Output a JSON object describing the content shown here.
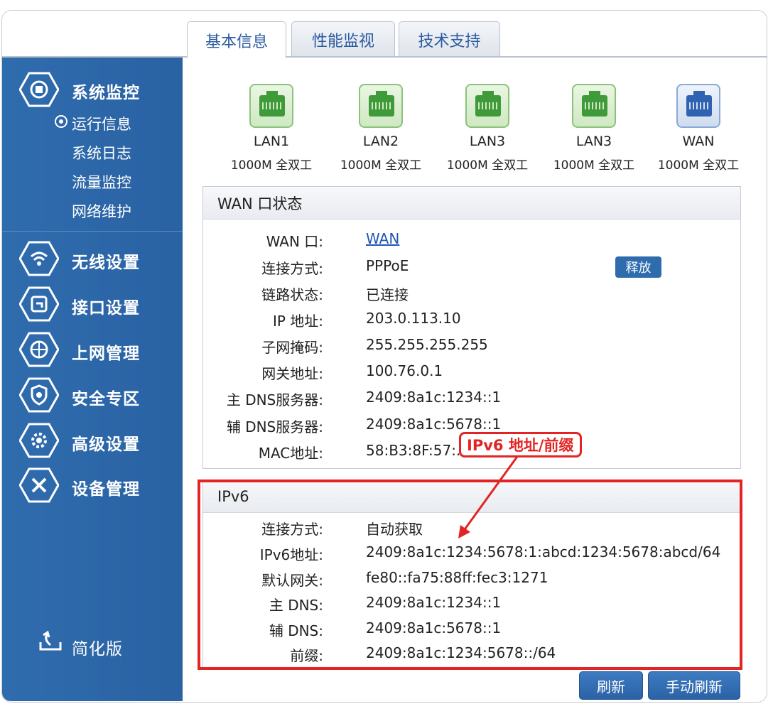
{
  "tabs": [
    {
      "label": "基本信息",
      "active": true
    },
    {
      "label": "性能监视",
      "active": false
    },
    {
      "label": "技术支持",
      "active": false
    }
  ],
  "sidebar": {
    "sections": [
      {
        "label": "系统监控",
        "icon": "router-icon"
      },
      {
        "label": "无线设置",
        "icon": "wifi-icon"
      },
      {
        "label": "接口设置",
        "icon": "interface-icon"
      },
      {
        "label": "上网管理",
        "icon": "globe-icon"
      },
      {
        "label": "安全专区",
        "icon": "shield-icon"
      },
      {
        "label": "高级设置",
        "icon": "gear-icon"
      },
      {
        "label": "设备管理",
        "icon": "tools-icon"
      }
    ],
    "subitems": [
      "运行信息",
      "系统日志",
      "流量监控",
      "网络维护"
    ],
    "active_subitem": "运行信息",
    "simple_mode": "简化版"
  },
  "ports": [
    {
      "name": "LAN1",
      "speed": "1000M 全双工",
      "type": "lan"
    },
    {
      "name": "LAN2",
      "speed": "1000M 全双工",
      "type": "lan"
    },
    {
      "name": "LAN3",
      "speed": "1000M 全双工",
      "type": "lan"
    },
    {
      "name": "LAN3",
      "speed": "1000M 全双工",
      "type": "lan"
    },
    {
      "name": "WAN",
      "speed": "1000M 全双工",
      "type": "wan"
    }
  ],
  "wan_status": {
    "title": "WAN 口状态",
    "rows": [
      {
        "label": "WAN 口:",
        "value": "WAN"
      },
      {
        "label": "连接方式:",
        "value": "PPPoE"
      },
      {
        "label": "链路状态:",
        "value": "已连接"
      },
      {
        "label": "IP 地址:",
        "value": "203.0.113.10"
      },
      {
        "label": "子网掩码:",
        "value": "255.255.255.255"
      },
      {
        "label": "网关地址:",
        "value": "100.76.0.1"
      },
      {
        "label": "主 DNS服务器:",
        "value": "2409:8a1c:1234::1"
      },
      {
        "label": "辅 DNS服务器:",
        "value": "2409:8a1c:5678::1"
      },
      {
        "label": "MAC地址:",
        "value": "58:B3:8F:57:..."
      }
    ],
    "release_button": "释放"
  },
  "ipv6": {
    "title": "IPv6",
    "rows": [
      {
        "label": "连接方式:",
        "value": "自动获取"
      },
      {
        "label": "IPv6地址:",
        "value": "2409:8a1c:1234:5678:1:abcd:1234:5678:abcd/64"
      },
      {
        "label": "默认网关:",
        "value": "fe80::fa75:88ff:fec3:1271"
      },
      {
        "label": "主 DNS:",
        "value": "2409:8a1c:1234::1"
      },
      {
        "label": "辅 DNS:",
        "value": "2409:8a1c:5678::1"
      },
      {
        "label": "前缀:",
        "value": "2409:8a1c:1234:5678::/64"
      }
    ]
  },
  "annotation": {
    "label": "IPv6 地址/前缀",
    "color": "#e22424"
  },
  "buttons": {
    "refresh": "刷新",
    "manual_refresh": "手动刷新"
  },
  "colors": {
    "sidebar": "#2f6cae",
    "accent": "#2a5aa0",
    "lan_port": "#3f9a39",
    "wan_port": "#2f62b1"
  }
}
